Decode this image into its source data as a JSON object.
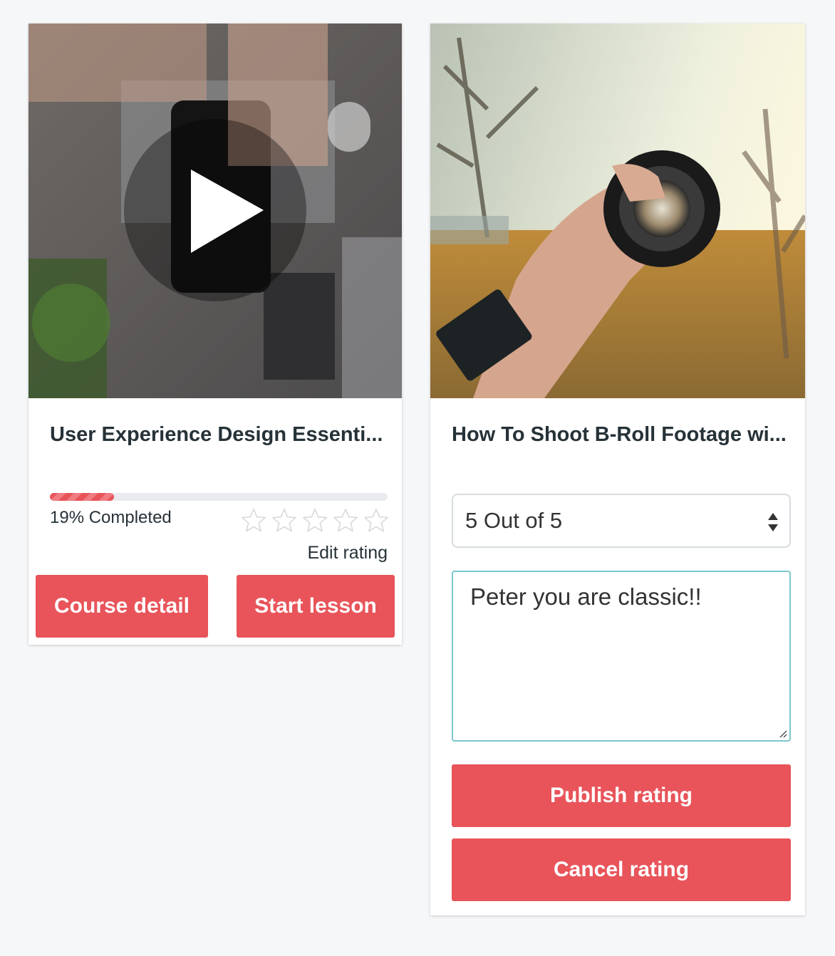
{
  "courses": [
    {
      "title": "User Experience Design Essenti...",
      "progress_percent": 19,
      "progress_text": "19% Completed",
      "rating_stars_filled": 0,
      "rating_stars_total": 5,
      "edit_rating_label": "Edit rating",
      "course_detail_label": "Course detail",
      "start_lesson_label": "Start lesson"
    },
    {
      "title": "How To Shoot B-Roll Footage wi...",
      "rating_select_value": "5 Out of 5",
      "review_text": "Peter you are classic!!",
      "publish_label": "Publish rating",
      "cancel_label": "Cancel rating"
    }
  ],
  "colors": {
    "accent": "#e8545a",
    "text": "#263238",
    "page_background": "#f6f7f9",
    "textarea_focus_border": "#7cc7cf"
  },
  "icons": [
    "play-icon",
    "star-outline-icon",
    "select-arrows-icon",
    "resize-grip-icon"
  ]
}
